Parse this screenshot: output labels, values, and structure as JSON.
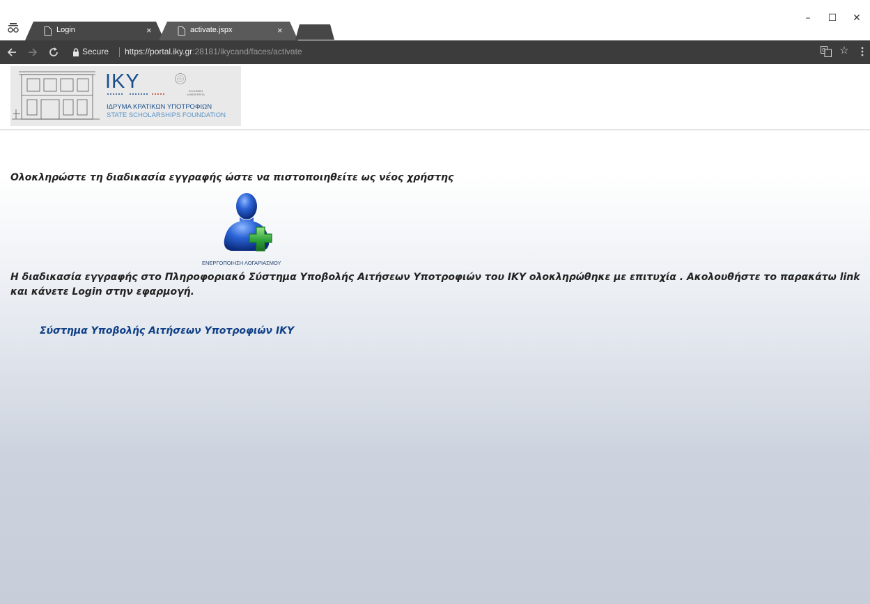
{
  "browser": {
    "tabs": [
      {
        "title": "Login",
        "close": "×",
        "active": false
      },
      {
        "title": "activate.jspx",
        "close": "×",
        "active": true
      }
    ],
    "window_controls": {
      "minimize": "–",
      "maximize": "☐",
      "close": "✕"
    },
    "address_bar": {
      "security_label": "Secure",
      "url_scheme": "https://",
      "url_host": "portal.iky.gr",
      "url_rest": ":28181/ikycand/faces/activate"
    },
    "icons": [
      "incognito-icon",
      "back-icon",
      "forward-icon",
      "reload-icon",
      "lock-icon",
      "translate-icon",
      "star-icon",
      "menu-icon"
    ],
    "colors": {
      "toolbar": "#3c3c3c",
      "tab_active": "#5a5a5a",
      "tab_inactive": "#474747"
    }
  },
  "header": {
    "logo": {
      "acronym": "IKY",
      "name_greek": "ΙΔΡΥΜΑ ΚΡΑΤΙΚΩΝ ΥΠΟΤΡΟΦΙΩΝ",
      "name_english": "STATE SCHOLARSHIPS FOUNDATION",
      "seal_text": "ΕΛΛΗΝΙΚΗ ΔΗΜΟΚΡΑΤΙΑ"
    }
  },
  "content": {
    "heading": "Ολοκληρώστε τη διαδικασία εγγραφής ώστε να πιστοποιηθείτε ως νέος χρήστης",
    "icon_caption": "ΕΝΕΡΓΟΠΟΙΗΣΗ ΛΟΓΑΡΙΑΣΜΟΥ",
    "message": "Η διαδικασία εγγραφής στο Πληροφοριακό Σύστημα Υποβολής Αιτήσεων Υποτροφιών του ΙΚΥ ολοκληρώθηκε με επιτυχία . Ακολουθήστε το παρακάτω link και κάνετε Login στην εφαρμογή.",
    "link_text": "Σύστημα Υποβολής Αιτήσεων Υποτροφιών ΙΚΥ"
  },
  "colors": {
    "brand_blue": "#1a4f8c",
    "link_blue": "#0f3f86",
    "icon_green": "#2fa33a",
    "icon_blue": "#1d56c4"
  }
}
